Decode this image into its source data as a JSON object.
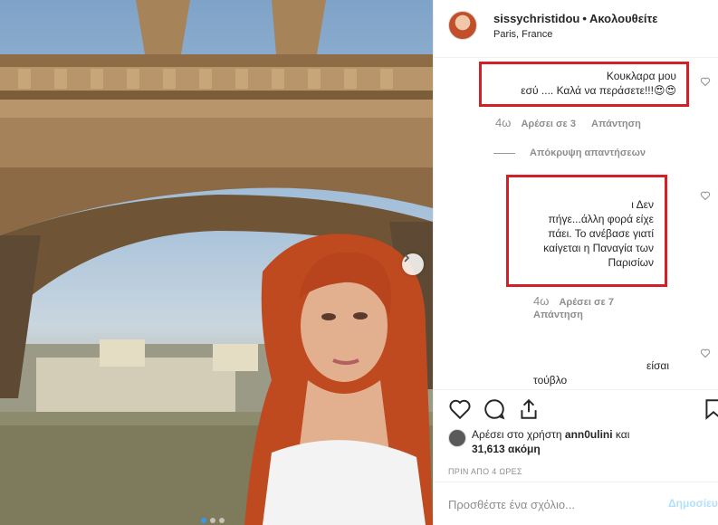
{
  "post": {
    "username": "sissychristidou",
    "separator": "•",
    "follow_label": "Ακολουθείτε",
    "location": "Paris, France"
  },
  "comments": [
    {
      "lines": [
        "Κουκλαρα μου",
        "εσύ .... Καλά να περάσετε!!!😍😍"
      ],
      "age": "4ω",
      "likes": "Αρέσει σε 3",
      "reply": "Απάντηση",
      "highlighted": true
    },
    {
      "lines": [
        "ι Δεν",
        "πήγε...άλλη φορά είχε",
        "πάει. Το ανέβασε γιατί",
        "καίγεται η Παναγία των",
        "Παρισίων"
      ],
      "age": "4ω",
      "likes": "Αρέσει σε 7",
      "reply": "Απάντηση",
      "highlighted": true
    },
    {
      "lines": [
        "είσαι"
      ],
      "partial": "τούβλο"
    }
  ],
  "hide_replies": "Απόκρυψη απαντήσεων",
  "likes": {
    "prefix": "Αρέσει στο χρήστη",
    "user": "ann0ulini",
    "and": "και",
    "count": "31,613",
    "suffix": "ακόμη"
  },
  "timestamp": "ΠΡΙΝ ΑΠΟ 4 ΩΡΕΣ",
  "add_comment": {
    "placeholder": "Προσθέστε ένα σχόλιο...",
    "post_label": "Δημοσίευση"
  },
  "icons": {
    "like": "heart-icon",
    "comment": "comment-icon",
    "share": "share-icon",
    "save": "bookmark-icon",
    "next": "chevron-right-icon"
  },
  "colors": {
    "highlight": "#d32027",
    "link": "#3897f0",
    "muted": "#8e8e8e",
    "post_button": "#b2dffc"
  },
  "carousel": {
    "count": 3,
    "active": 1
  }
}
